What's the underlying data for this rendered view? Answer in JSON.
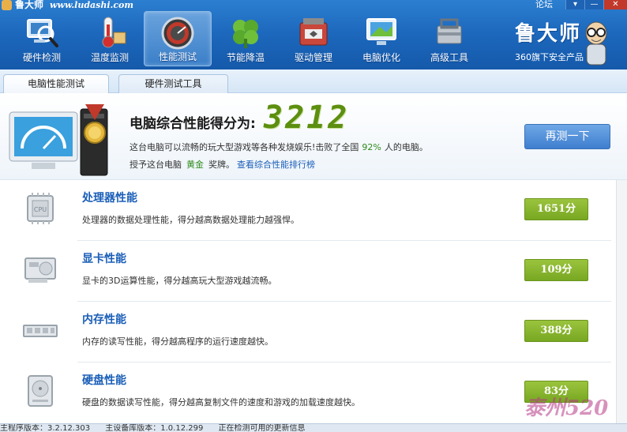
{
  "window": {
    "title": "鲁大师",
    "site": "www.ludashi.com",
    "forum_link": "论坛",
    "menu_btn": "▾",
    "min_btn": "—",
    "close_btn": "✕"
  },
  "toolbar": [
    {
      "label": "硬件检测",
      "icon": "magnifier-monitor-icon"
    },
    {
      "label": "温度监测",
      "icon": "thermometer-icon"
    },
    {
      "label": "性能测试",
      "icon": "speedometer-icon",
      "active": true
    },
    {
      "label": "节能降温",
      "icon": "clover-icon"
    },
    {
      "label": "驱动管理",
      "icon": "toolbox-icon"
    },
    {
      "label": "电脑优化",
      "icon": "monitor-icon"
    },
    {
      "label": "高级工具",
      "icon": "tools-icon"
    }
  ],
  "brand": {
    "logo": "鲁大师",
    "slogan": "360旗下安全产品"
  },
  "tabs": [
    {
      "label": "电脑性能测试",
      "active": true
    },
    {
      "label": "硬件测试工具",
      "active": false
    }
  ],
  "summary": {
    "title": "电脑综合性能得分为:",
    "score": "3212",
    "desc_before": "这台电脑可以流畅的玩大型游戏等各种发烧娱乐!击败了全国",
    "percent": "92%",
    "desc_after": "人的电脑。",
    "award_before": "授予这台电脑",
    "medal": "黄金",
    "award_after": "奖牌。",
    "rank_link": "查看综合性能排行榜",
    "retest_label": "再测一下"
  },
  "components": [
    {
      "title": "处理器性能",
      "desc": "处理器的数据处理性能，得分越高数据处理能力越强悍。",
      "score": "1651分",
      "icon": "cpu-icon"
    },
    {
      "title": "显卡性能",
      "desc": "显卡的3D运算性能，得分越高玩大型游戏越流畅。",
      "score": "109分",
      "icon": "graphics-card-icon"
    },
    {
      "title": "内存性能",
      "desc": "内存的读写性能，得分越高程序的运行速度越快。",
      "score": "388分",
      "icon": "memory-stick-icon"
    },
    {
      "title": "硬盘性能",
      "desc": "硬盘的数据读写性能，得分越高复制文件的速度和游戏的加载速度越快。",
      "score": "83分",
      "icon": "hard-disk-icon"
    }
  ],
  "status": {
    "program_version": "主程序版本：3.2.12.303",
    "db_version": "主设备库版本：1.0.12.299",
    "update_msg": "正在检测可用的更新信息"
  },
  "watermark": "泰州520"
}
